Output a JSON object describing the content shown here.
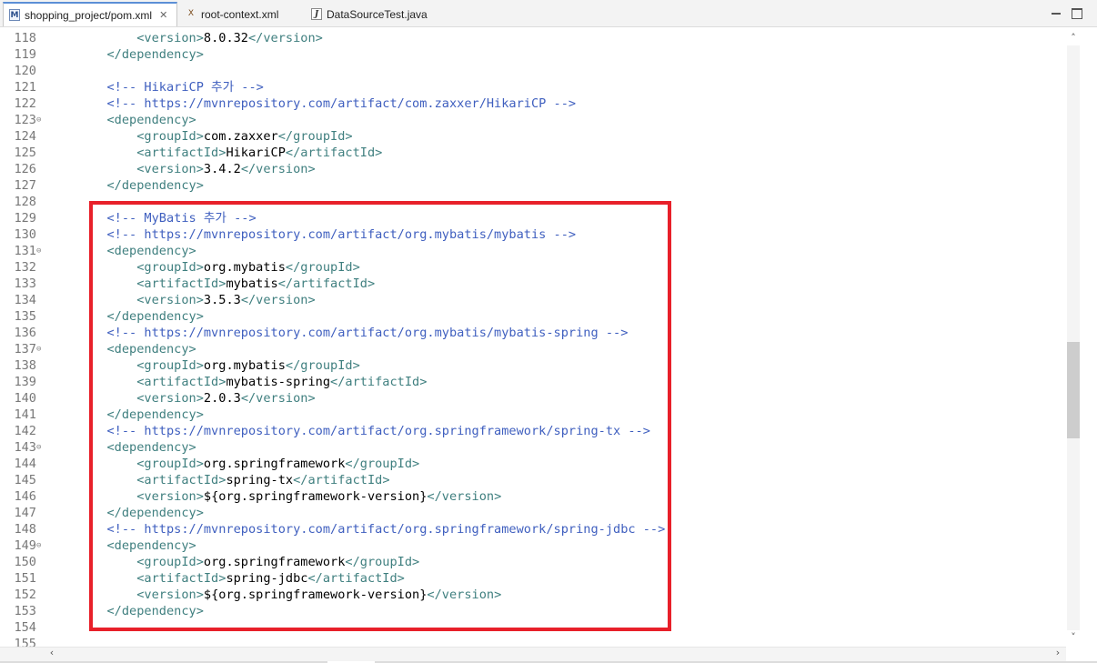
{
  "tabs": [
    {
      "label": "shopping_project/pom.xml",
      "icon": "xml-file-icon",
      "active": true,
      "close": "✕"
    },
    {
      "label": "root-context.xml",
      "icon": "xml-context-file-icon",
      "active": false
    },
    {
      "label": "DataSourceTest.java",
      "icon": "java-file-icon",
      "active": false
    }
  ],
  "colors": {
    "tag": "#3f7f7f",
    "comment": "#3f5fbf",
    "text": "#000000",
    "line_number": "#787878",
    "highlight_box": "#e8202a"
  },
  "lines": [
    {
      "n": "118",
      "fold": "",
      "parts": [
        [
          "s",
          "            "
        ],
        [
          "tag",
          "<version>"
        ],
        [
          "txt",
          "8.0.32"
        ],
        [
          "tag",
          "</version>"
        ]
      ]
    },
    {
      "n": "119",
      "fold": "",
      "parts": [
        [
          "s",
          "        "
        ],
        [
          "tag",
          "</dependency>"
        ]
      ]
    },
    {
      "n": "120",
      "fold": "",
      "parts": []
    },
    {
      "n": "121",
      "fold": "",
      "parts": [
        [
          "s",
          "        "
        ],
        [
          "cmt",
          "<!-- HikariCP 추가 -->"
        ]
      ]
    },
    {
      "n": "122",
      "fold": "",
      "parts": [
        [
          "s",
          "        "
        ],
        [
          "cmt",
          "<!-- https://mvnrepository.com/artifact/com.zaxxer/HikariCP -->"
        ]
      ]
    },
    {
      "n": "123",
      "fold": "⊖",
      "parts": [
        [
          "s",
          "        "
        ],
        [
          "tag",
          "<dependency>"
        ]
      ]
    },
    {
      "n": "124",
      "fold": "",
      "parts": [
        [
          "s",
          "            "
        ],
        [
          "tag",
          "<groupId>"
        ],
        [
          "txt",
          "com.zaxxer"
        ],
        [
          "tag",
          "</groupId>"
        ]
      ]
    },
    {
      "n": "125",
      "fold": "",
      "parts": [
        [
          "s",
          "            "
        ],
        [
          "tag",
          "<artifactId>"
        ],
        [
          "txt",
          "HikariCP"
        ],
        [
          "tag",
          "</artifactId>"
        ]
      ]
    },
    {
      "n": "126",
      "fold": "",
      "parts": [
        [
          "s",
          "            "
        ],
        [
          "tag",
          "<version>"
        ],
        [
          "txt",
          "3.4.2"
        ],
        [
          "tag",
          "</version>"
        ]
      ]
    },
    {
      "n": "127",
      "fold": "",
      "parts": [
        [
          "s",
          "        "
        ],
        [
          "tag",
          "</dependency>"
        ]
      ]
    },
    {
      "n": "128",
      "fold": "",
      "parts": []
    },
    {
      "n": "129",
      "fold": "",
      "parts": [
        [
          "s",
          "        "
        ],
        [
          "cmt",
          "<!-- MyBatis 추가 -->"
        ]
      ]
    },
    {
      "n": "130",
      "fold": "",
      "parts": [
        [
          "s",
          "        "
        ],
        [
          "cmt",
          "<!-- https://mvnrepository.com/artifact/org.mybatis/mybatis -->"
        ]
      ]
    },
    {
      "n": "131",
      "fold": "⊖",
      "parts": [
        [
          "s",
          "        "
        ],
        [
          "tag",
          "<dependency>"
        ]
      ]
    },
    {
      "n": "132",
      "fold": "",
      "parts": [
        [
          "s",
          "            "
        ],
        [
          "tag",
          "<groupId>"
        ],
        [
          "txt",
          "org.mybatis"
        ],
        [
          "tag",
          "</groupId>"
        ]
      ]
    },
    {
      "n": "133",
      "fold": "",
      "parts": [
        [
          "s",
          "            "
        ],
        [
          "tag",
          "<artifactId>"
        ],
        [
          "txt",
          "mybatis"
        ],
        [
          "tag",
          "</artifactId>"
        ]
      ]
    },
    {
      "n": "134",
      "fold": "",
      "parts": [
        [
          "s",
          "            "
        ],
        [
          "tag",
          "<version>"
        ],
        [
          "txt",
          "3.5.3"
        ],
        [
          "tag",
          "</version>"
        ]
      ]
    },
    {
      "n": "135",
      "fold": "",
      "parts": [
        [
          "s",
          "        "
        ],
        [
          "tag",
          "</dependency>"
        ]
      ]
    },
    {
      "n": "136",
      "fold": "",
      "parts": [
        [
          "s",
          "        "
        ],
        [
          "cmt",
          "<!-- https://mvnrepository.com/artifact/org.mybatis/mybatis-spring -->"
        ]
      ]
    },
    {
      "n": "137",
      "fold": "⊖",
      "parts": [
        [
          "s",
          "        "
        ],
        [
          "tag",
          "<dependency>"
        ]
      ]
    },
    {
      "n": "138",
      "fold": "",
      "parts": [
        [
          "s",
          "            "
        ],
        [
          "tag",
          "<groupId>"
        ],
        [
          "txt",
          "org.mybatis"
        ],
        [
          "tag",
          "</groupId>"
        ]
      ]
    },
    {
      "n": "139",
      "fold": "",
      "parts": [
        [
          "s",
          "            "
        ],
        [
          "tag",
          "<artifactId>"
        ],
        [
          "txt",
          "mybatis-spring"
        ],
        [
          "tag",
          "</artifactId>"
        ]
      ]
    },
    {
      "n": "140",
      "fold": "",
      "parts": [
        [
          "s",
          "            "
        ],
        [
          "tag",
          "<version>"
        ],
        [
          "txt",
          "2.0.3"
        ],
        [
          "tag",
          "</version>"
        ]
      ]
    },
    {
      "n": "141",
      "fold": "",
      "parts": [
        [
          "s",
          "        "
        ],
        [
          "tag",
          "</dependency>"
        ]
      ]
    },
    {
      "n": "142",
      "fold": "",
      "parts": [
        [
          "s",
          "        "
        ],
        [
          "cmt",
          "<!-- https://mvnrepository.com/artifact/org.springframework/spring-tx -->"
        ]
      ]
    },
    {
      "n": "143",
      "fold": "⊖",
      "parts": [
        [
          "s",
          "        "
        ],
        [
          "tag",
          "<dependency>"
        ]
      ]
    },
    {
      "n": "144",
      "fold": "",
      "parts": [
        [
          "s",
          "            "
        ],
        [
          "tag",
          "<groupId>"
        ],
        [
          "txt",
          "org.springframework"
        ],
        [
          "tag",
          "</groupId>"
        ]
      ]
    },
    {
      "n": "145",
      "fold": "",
      "parts": [
        [
          "s",
          "            "
        ],
        [
          "tag",
          "<artifactId>"
        ],
        [
          "txt",
          "spring-tx"
        ],
        [
          "tag",
          "</artifactId>"
        ]
      ]
    },
    {
      "n": "146",
      "fold": "",
      "parts": [
        [
          "s",
          "            "
        ],
        [
          "tag",
          "<version>"
        ],
        [
          "txt",
          "${org.springframework-version}"
        ],
        [
          "tag",
          "</version>"
        ]
      ]
    },
    {
      "n": "147",
      "fold": "",
      "parts": [
        [
          "s",
          "        "
        ],
        [
          "tag",
          "</dependency>"
        ]
      ]
    },
    {
      "n": "148",
      "fold": "",
      "parts": [
        [
          "s",
          "        "
        ],
        [
          "cmt",
          "<!-- https://mvnrepository.com/artifact/org.springframework/spring-jdbc -->"
        ]
      ]
    },
    {
      "n": "149",
      "fold": "⊖",
      "parts": [
        [
          "s",
          "        "
        ],
        [
          "tag",
          "<dependency>"
        ]
      ]
    },
    {
      "n": "150",
      "fold": "",
      "parts": [
        [
          "s",
          "            "
        ],
        [
          "tag",
          "<groupId>"
        ],
        [
          "txt",
          "org.springframework"
        ],
        [
          "tag",
          "</groupId>"
        ]
      ]
    },
    {
      "n": "151",
      "fold": "",
      "parts": [
        [
          "s",
          "            "
        ],
        [
          "tag",
          "<artifactId>"
        ],
        [
          "txt",
          "spring-jdbc"
        ],
        [
          "tag",
          "</artifactId>"
        ]
      ]
    },
    {
      "n": "152",
      "fold": "",
      "parts": [
        [
          "s",
          "            "
        ],
        [
          "tag",
          "<version>"
        ],
        [
          "txt",
          "${org.springframework-version}"
        ],
        [
          "tag",
          "</version>"
        ]
      ]
    },
    {
      "n": "153",
      "fold": "",
      "parts": [
        [
          "s",
          "        "
        ],
        [
          "tag",
          "</dependency>"
        ]
      ]
    },
    {
      "n": "154",
      "fold": "",
      "parts": []
    },
    {
      "n": "155",
      "fold": "",
      "parts": []
    }
  ],
  "scroll": {
    "up": "˄",
    "down": "˅",
    "left": "‹",
    "right": "›"
  }
}
